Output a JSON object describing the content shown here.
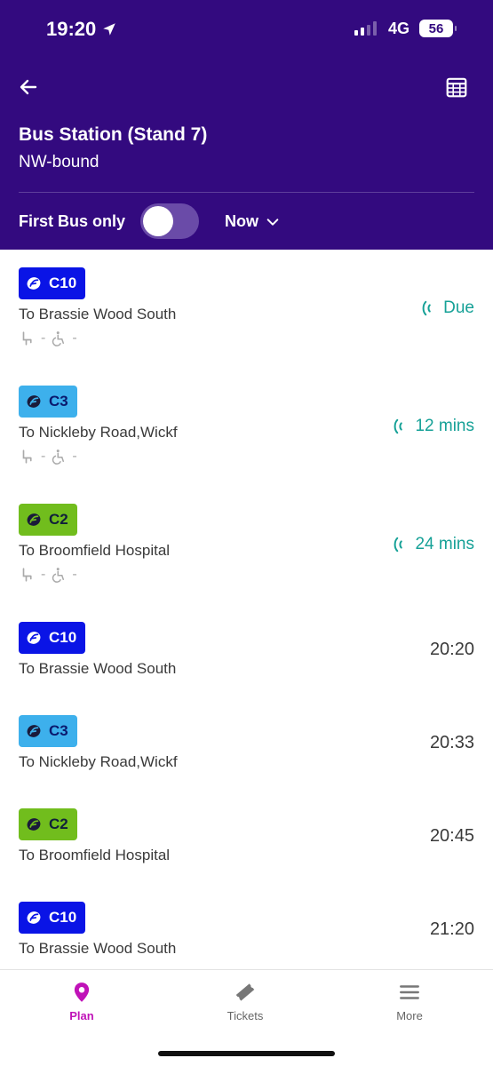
{
  "status": {
    "time": "19:20",
    "network": "4G",
    "battery": "56"
  },
  "header": {
    "stop_name": "Bus Station (Stand 7)",
    "direction": "NW-bound",
    "filter_label": "First Bus only",
    "time_select": "Now"
  },
  "departures": [
    {
      "route": "C10",
      "color": "#0A14E6",
      "text": "#ffffff",
      "destination": "To Brassie Wood South",
      "eta": "Due",
      "live": true,
      "seat": "-",
      "wheelchair": "-"
    },
    {
      "route": "C3",
      "color": "#3DB0EC",
      "text": "#0A1A6E",
      "destination": "To Nickleby Road,Wickf",
      "eta": "12 mins",
      "live": true,
      "seat": "-",
      "wheelchair": "-"
    },
    {
      "route": "C2",
      "color": "#71BD1D",
      "text": "#10203A",
      "destination": "To Broomfield Hospital",
      "eta": "24 mins",
      "live": true,
      "seat": "-",
      "wheelchair": "-"
    },
    {
      "route": "C10",
      "color": "#0A14E6",
      "text": "#ffffff",
      "destination": "To Brassie Wood South",
      "eta": "20:20",
      "live": false
    },
    {
      "route": "C3",
      "color": "#3DB0EC",
      "text": "#0A1A6E",
      "destination": "To Nickleby Road,Wickf",
      "eta": "20:33",
      "live": false
    },
    {
      "route": "C2",
      "color": "#71BD1D",
      "text": "#10203A",
      "destination": "To Broomfield Hospital",
      "eta": "20:45",
      "live": false
    },
    {
      "route": "C10",
      "color": "#0A14E6",
      "text": "#ffffff",
      "destination": "To Brassie Wood South",
      "eta": "21:20",
      "live": false
    }
  ],
  "tabs": {
    "plan": "Plan",
    "tickets": "Tickets",
    "more": "More"
  },
  "colors": {
    "header": "#330A7F",
    "live": "#16A197",
    "active_tab": "#C013B8"
  },
  "icons": {
    "back": "arrow-left-icon",
    "calendar": "calendar-icon",
    "location": "location-arrow-icon"
  }
}
